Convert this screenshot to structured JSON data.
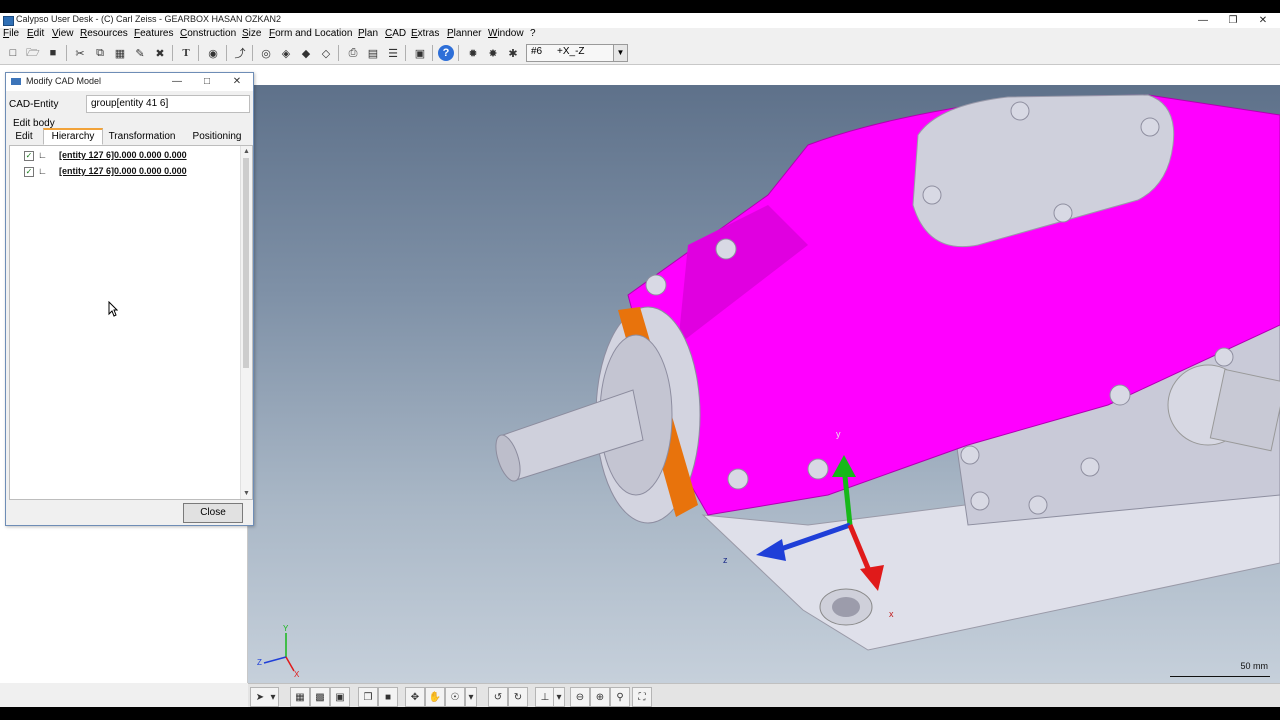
{
  "window": {
    "title": "Calypso User Desk - (C) Carl Zeiss - GEARBOX HASAN OZKAN2",
    "minimize_icon": "minimize-icon",
    "maximize_icon": "maximize-icon",
    "close_icon": "close-icon"
  },
  "menu": {
    "items": [
      "File",
      "Edit",
      "View",
      "Resources",
      "Features",
      "Construction",
      "Size",
      "Form and Location",
      "Plan",
      "CAD",
      "Extras",
      "Planner",
      "Window",
      "?"
    ]
  },
  "toolbar": {
    "view_combo": {
      "number": "#6",
      "direction": "+X_-Z"
    }
  },
  "dialog": {
    "title": "Modify CAD Model",
    "cad_entity_label": "CAD-Entity",
    "cad_entity_value": "group[entity 41 6]",
    "edit_body": "Edit body",
    "tabs": [
      "Edit",
      "Hierarchy",
      "Transformation",
      "Positioning"
    ],
    "active_tab": "Hierarchy",
    "tree_items": [
      {
        "label": "[entity 127 6]0.000 0.000 0.000",
        "checked": true
      },
      {
        "label": "[entity 127 6]0.000 0.000 0.000",
        "checked": true
      }
    ],
    "close_label": "Close"
  },
  "viewport": {
    "axis_labels": {
      "x": "X",
      "y": "Y",
      "z": "Z"
    },
    "triad_labels": {
      "x": "x",
      "y": "y",
      "z": "z"
    },
    "scale_label": "50 mm",
    "model_color": "#ff00ff",
    "background_top": "#5e718a",
    "background_bottom": "#c6d0db"
  }
}
